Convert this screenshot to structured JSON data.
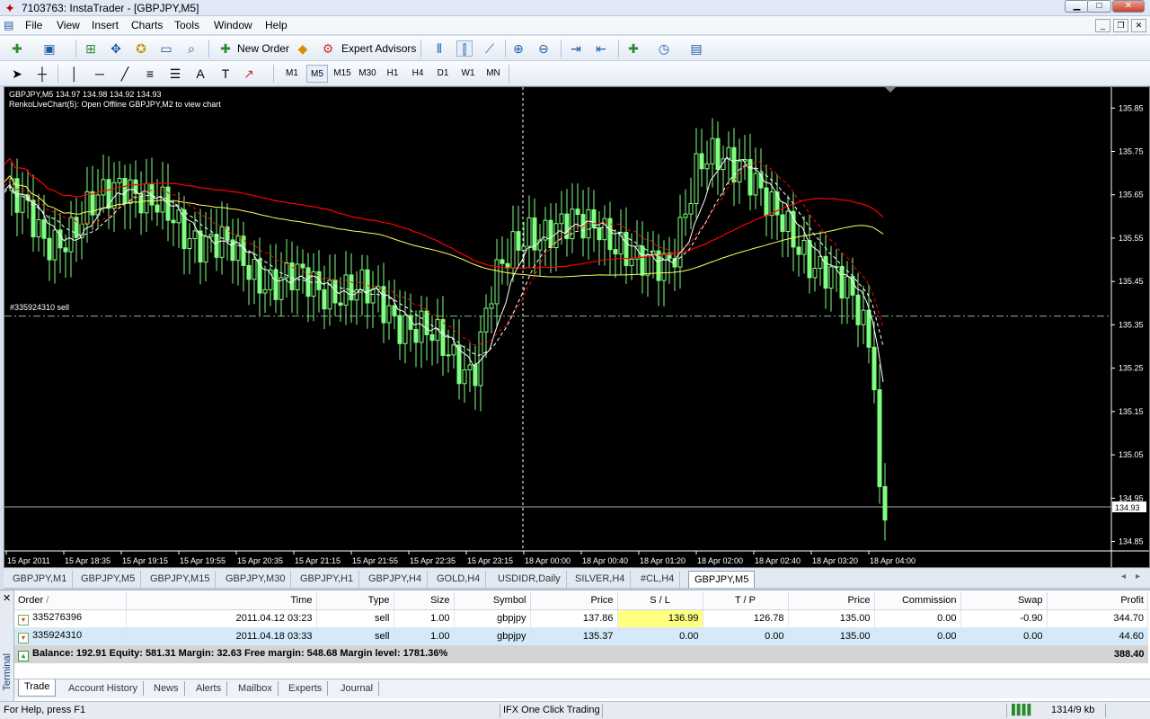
{
  "window": {
    "title": "7103763: InstaTrader - [GBPJPY,M5]",
    "buttons": [
      "minimize",
      "maximize",
      "close"
    ]
  },
  "menu": [
    "File",
    "View",
    "Insert",
    "Charts",
    "Tools",
    "Window",
    "Help"
  ],
  "toolbar1": {
    "new_order": "New Order",
    "expert_advisors": "Expert Advisors"
  },
  "timeframes": [
    "M1",
    "M5",
    "M15",
    "M30",
    "H1",
    "H4",
    "D1",
    "W1",
    "MN"
  ],
  "timeframe_active": "M5",
  "chart": {
    "info_line1": "GBPJPY,M5  134.97 134.98 134.92 134.93",
    "info_line2": "RenkoLiveChart(5): Open Offline GBPJPY,M2 to view chart",
    "order_line_label": "#335924310 sell",
    "current_price": "134.93",
    "price_labels": [
      "135.85",
      "135.75",
      "135.65",
      "135.55",
      "135.45",
      "135.35",
      "135.25",
      "135.15",
      "135.05",
      "134.95",
      "134.85"
    ],
    "time_labels": [
      "15 Apr 2011",
      "15 Apr 18:35",
      "15 Apr 19:15",
      "15 Apr 19:55",
      "15 Apr 20:35",
      "15 Apr 21:15",
      "15 Apr 21:55",
      "15 Apr 22:35",
      "15 Apr 23:15",
      "18 Apr 00:00",
      "18 Apr 00:40",
      "18 Apr 01:20",
      "18 Apr 02:00",
      "18 Apr 02:40",
      "18 Apr 03:20",
      "18 Apr 04:00"
    ],
    "colors": {
      "bg": "#000000",
      "candle": "#7fff7f",
      "ma_slow": "#ff0000",
      "ma_yellow": "#ffff60",
      "ma_fast": "#ffffff"
    }
  },
  "chart_tabs": [
    "GBPJPY,M1",
    "GBPJPY,M5",
    "GBPJPY,M15",
    "GBPJPY,M30",
    "GBPJPY,H1",
    "GBPJPY,H4",
    "GOLD,H4",
    "USDIDR,Daily",
    "SILVER,H4",
    "#CL,H4",
    "GBPJPY,M5"
  ],
  "terminal": {
    "label": "Terminal",
    "columns": [
      "Order",
      "Time",
      "Type",
      "Size",
      "Symbol",
      "Price",
      "S / L",
      "T / P",
      "Price",
      "Commission",
      "Swap",
      "Profit"
    ],
    "rows": [
      {
        "order": "335276396",
        "time": "2011.04.12 03:23",
        "type": "sell",
        "size": "1.00",
        "symbol": "gbpjpy",
        "price": "137.86",
        "sl": "136.99",
        "tp": "126.78",
        "cur_price": "135.00",
        "commission": "0.00",
        "swap": "-0.90",
        "profit": "344.70"
      },
      {
        "order": "335924310",
        "time": "2011.04.18 03:33",
        "type": "sell",
        "size": "1.00",
        "symbol": "gbpjpy",
        "price": "135.37",
        "sl": "0.00",
        "tp": "0.00",
        "cur_price": "135.00",
        "commission": "0.00",
        "swap": "0.00",
        "profit": "44.60"
      }
    ],
    "balance_line": "Balance: 192.91  Equity: 581.31  Margin: 32.63  Free margin: 548.68  Margin level: 1781.36%",
    "total_profit": "388.40",
    "tabs": [
      "Trade",
      "Account History",
      "News",
      "Alerts",
      "Mailbox",
      "Experts",
      "Journal"
    ]
  },
  "status": {
    "help": "For Help, press F1",
    "one_click": "IFX One Click Trading",
    "traffic": "1314/9 kb"
  }
}
